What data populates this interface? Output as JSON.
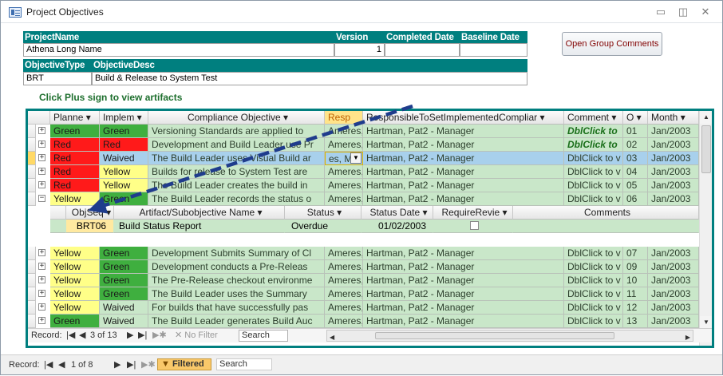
{
  "window": {
    "title": "Project Objectives",
    "minimize": "▭",
    "restore": "◫",
    "close": "✕"
  },
  "header": {
    "project_name_label": "ProjectName",
    "version_label": "Version",
    "completed_label": "Completed Date",
    "baseline_label": "Baseline Date",
    "project_name": "Athena Long Name",
    "version": "1",
    "completed_date": "",
    "baseline_date": "",
    "objective_type_label": "ObjectiveType",
    "objective_desc_label": "ObjectiveDesc",
    "objective_type": "BRT",
    "objective_desc": "Build & Release to System Test",
    "open_group_comments": "Open Group Comments",
    "plus_hint": "Click Plus sign to view artifacts"
  },
  "columns": [
    "Planne",
    "Implem",
    "Compliance Objective",
    "Resp",
    "ResponsibleToSetImplementedCompliar",
    "Comment",
    "O",
    "Month"
  ],
  "rows": [
    {
      "plan": "Green",
      "plan_c": "green",
      "impl": "Green",
      "impl_c": "green",
      "obj": "Versioning Standards are applied to",
      "resp": "Ameres,",
      "resp_full": "Hartman, Pat2 - Manager",
      "comment": "DblClick to",
      "bold": true,
      "o": "01",
      "month": "Jan/2003"
    },
    {
      "plan": "Red",
      "plan_c": "red",
      "impl": "Red",
      "impl_c": "red",
      "obj": "Development and Build Leader use Pr",
      "resp": "Ameres,",
      "resp_full": "Hartman, Pat2 - Manager",
      "comment": "DblClick to",
      "bold": true,
      "o": "02",
      "month": "Jan/2003"
    },
    {
      "plan": "Red",
      "plan_c": "red",
      "impl": "Waived",
      "impl_c": "waived",
      "obj": "The Build Leader uses Visual Build ar",
      "resp": "es, M",
      "resp_full": "Hartman, Pat2 - Manager",
      "comment": "DblClick to v",
      "bold": false,
      "o": "03",
      "month": "Jan/2003",
      "selected": true
    },
    {
      "plan": "Red",
      "plan_c": "red",
      "impl": "Yellow",
      "impl_c": "yellow",
      "obj": "Builds for release to System Test are",
      "resp": "Ameres,",
      "resp_full": "Hartman, Pat2 - Manager",
      "comment": "DblClick to v",
      "bold": false,
      "o": "04",
      "month": "Jan/2003"
    },
    {
      "plan": "Red",
      "plan_c": "red",
      "impl": "Yellow",
      "impl_c": "yellow",
      "obj": "The Build Leader creates the build in",
      "resp": "Ameres,",
      "resp_full": "Hartman, Pat2 - Manager",
      "comment": "DblClick to v",
      "bold": false,
      "o": "05",
      "month": "Jan/2003"
    },
    {
      "plan": "Yellow",
      "plan_c": "yellow",
      "impl": "Green",
      "impl_c": "green",
      "obj": "The Build Leader records the status o",
      "resp": "Ameres,",
      "resp_full": "Hartman, Pat2 - Manager",
      "comment": "DblClick to v",
      "bold": false,
      "o": "06",
      "month": "Jan/2003",
      "expanded": true
    }
  ],
  "rows_after": [
    {
      "plan": "Yellow",
      "plan_c": "yellow",
      "impl": "Green",
      "impl_c": "green",
      "obj": "Development Submits Summary of Cl",
      "resp": "Ameres,",
      "resp_full": "Hartman, Pat2 - Manager",
      "comment": "DblClick to v",
      "o": "07",
      "month": "Jan/2003"
    },
    {
      "plan": "Yellow",
      "plan_c": "yellow",
      "impl": "Green",
      "impl_c": "green",
      "obj": "Development conducts  a Pre-Releas",
      "resp": "Ameres,",
      "resp_full": "Hartman, Pat2 - Manager",
      "comment": "DblClick to v",
      "o": "09",
      "month": "Jan/2003"
    },
    {
      "plan": "Yellow",
      "plan_c": "yellow",
      "impl": "Green",
      "impl_c": "green",
      "obj": "The Pre-Release checkout environme",
      "resp": "Ameres,",
      "resp_full": "Hartman, Pat2 - Manager",
      "comment": "DblClick to v",
      "o": "10",
      "month": "Jan/2003"
    },
    {
      "plan": "Yellow",
      "plan_c": "yellow",
      "impl": "Green",
      "impl_c": "green",
      "obj": "The Build Leader uses the Summary",
      "resp": "Ameres,",
      "resp_full": "Hartman, Pat2 - Manager",
      "comment": "DblClick to v",
      "o": "11",
      "month": "Jan/2003"
    },
    {
      "plan": "Yellow",
      "plan_c": "yellow",
      "impl": "Waived",
      "impl_c": "waived",
      "obj": "For builds that have successfully pas",
      "resp": "Ameres,",
      "resp_full": "Hartman, Pat2 - Manager",
      "comment": "DblClick to v",
      "o": "12",
      "month": "Jan/2003"
    },
    {
      "plan": "Green",
      "plan_c": "green",
      "impl": "Waived",
      "impl_c": "waived",
      "obj": "The Build Leader generates Build Auc",
      "resp": "Ameres,",
      "resp_full": "Hartman, Pat2 - Manager",
      "comment": "DblClick to v",
      "o": "13",
      "month": "Jan/2003"
    }
  ],
  "subgrid": {
    "columns": [
      "ObjSeq",
      "Artifact/Subobjective Name",
      "Status",
      "Status Date",
      "RequireRevie",
      "Comments"
    ],
    "row": {
      "seq": "BRT06",
      "name": "Build Status Report",
      "status": "Overdue",
      "date": "01/02/2003",
      "require": false,
      "comments": ""
    }
  },
  "subnav": {
    "label": "Record:",
    "position": "3 of 13",
    "filter": "No Filter",
    "search": "Search"
  },
  "mainnav": {
    "label": "Record:",
    "position": "1 of 8",
    "filter": "Filtered",
    "search": "Search"
  },
  "colors": {
    "teal": "#007f7f",
    "green": "#3faf3f",
    "red": "#ff1a1a",
    "yellow": "#ffff88",
    "waived": "#c9e7c9",
    "arrow": "#1f3c8c"
  }
}
